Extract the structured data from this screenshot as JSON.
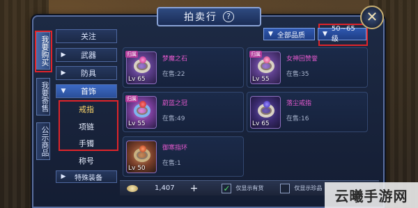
{
  "window": {
    "title": "拍卖行",
    "close_label": "✕"
  },
  "side_tabs": [
    {
      "label": "我要购买",
      "active": true
    },
    {
      "label": "我要寄售",
      "active": false
    },
    {
      "label": "公示商品",
      "active": false
    }
  ],
  "nav": {
    "items": [
      {
        "label": "关注",
        "has_arrow": false
      },
      {
        "label": "武器",
        "has_arrow": true
      },
      {
        "label": "防具",
        "has_arrow": true
      },
      {
        "label": "首饰",
        "has_arrow": true,
        "expanded": true
      }
    ],
    "subitems": [
      "戒指",
      "项链",
      "手镯",
      "称号"
    ],
    "selected_subitem": "戒指",
    "bottom_item": "特殊装备"
  },
  "filters": {
    "quality": "全部品质",
    "level": "50~65级"
  },
  "items": [
    {
      "name": "梦魔之石",
      "level": "Lv 65",
      "stock": "在售:22"
    },
    {
      "name": "女神回赞誉",
      "level": "Lv 55",
      "stock": "在售:35"
    },
    {
      "name": "蔚蓝之冠",
      "level": "Lv 55",
      "stock": "在售:49"
    },
    {
      "name": "落尘戒指",
      "level": "Lv 65",
      "stock": "在售:16"
    },
    {
      "name": "御寒指环",
      "level": "Lv 50",
      "stock": "在售:1"
    }
  ],
  "item_tag": "归属",
  "bottom": {
    "coins": "1,407",
    "opt1": "仅显示有货",
    "opt2": "仅显示珍品"
  },
  "watermark": "云曦手游网",
  "colors": {
    "highlight_box": "#e0242a",
    "item_name": "#e85ad0"
  }
}
